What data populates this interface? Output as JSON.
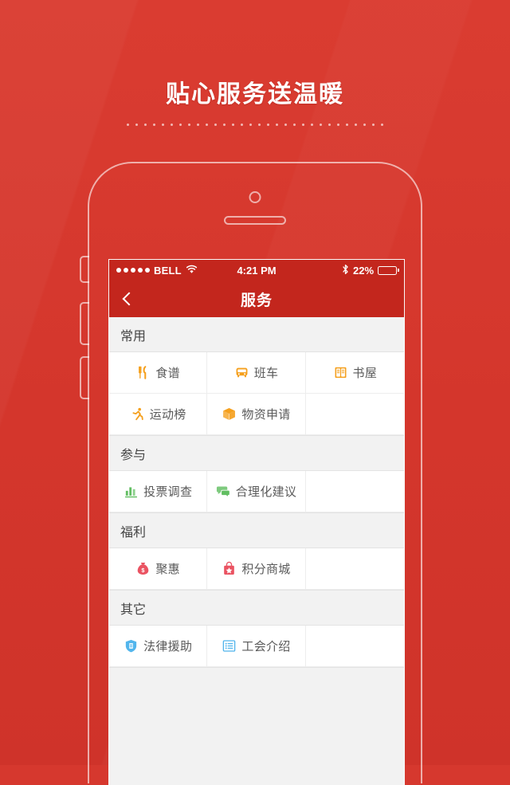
{
  "poster": {
    "headline": "贴心服务送温暖",
    "background_color": "#d6382e",
    "accent_color": "#c3261d"
  },
  "statusbar": {
    "signal_dots": 5,
    "carrier": "BELL",
    "wifi_icon": "wifi-icon",
    "time": "4:21 PM",
    "bluetooth_icon": "bluetooth-icon",
    "battery_percent": "22%",
    "battery_level": 22
  },
  "navbar": {
    "back_icon": "chevron-left-icon",
    "title": "服务"
  },
  "sections": [
    {
      "title": "常用",
      "items": [
        {
          "label": "食谱",
          "icon": "cutlery-icon",
          "color": "#f5a01e"
        },
        {
          "label": "班车",
          "icon": "bus-icon",
          "color": "#f5a01e"
        },
        {
          "label": "书屋",
          "icon": "book-icon",
          "color": "#f5a01e"
        },
        {
          "label": "运动榜",
          "icon": "runner-icon",
          "color": "#f5a01e"
        },
        {
          "label": "物资申请",
          "icon": "box-icon",
          "color": "#f5a01e"
        }
      ]
    },
    {
      "title": "参与",
      "items": [
        {
          "label": "投票调查",
          "icon": "bar-chart-icon",
          "color": "#62be62"
        },
        {
          "label": "合理化建议",
          "icon": "chat-icon",
          "color": "#62be62"
        }
      ]
    },
    {
      "title": "福利",
      "items": [
        {
          "label": "聚惠",
          "icon": "money-bag-icon",
          "color": "#ea5362"
        },
        {
          "label": "积分商城",
          "icon": "shopping-bag-icon",
          "color": "#ea5362"
        }
      ]
    },
    {
      "title": "其它",
      "items": [
        {
          "label": "法律援助",
          "icon": "shield-icon",
          "color": "#52b5ec"
        },
        {
          "label": "工会介绍",
          "icon": "list-icon",
          "color": "#52b5ec"
        }
      ]
    }
  ]
}
